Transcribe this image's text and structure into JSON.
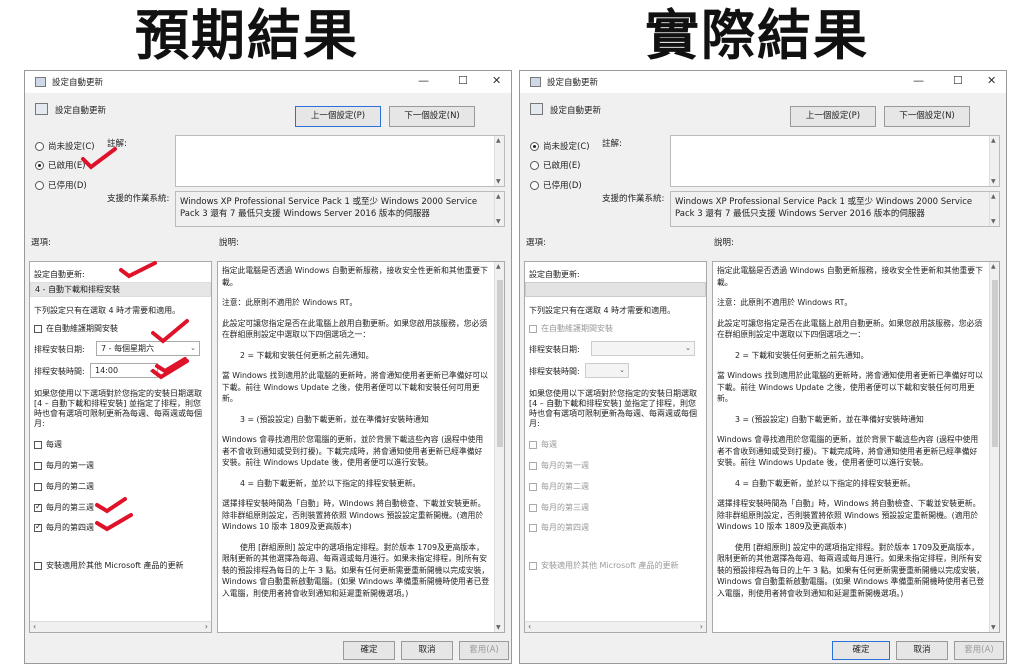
{
  "left": {
    "heading": "預期結果",
    "title": "設定自動更新",
    "subtitle": "設定自動更新",
    "prev_label": "上一個設定(P)",
    "next_label": "下一個設定(N)",
    "radio_not_configured": "尚未設定(C)",
    "radio_enabled": "已啟用(E)",
    "radio_disabled": "已停用(D)",
    "comment_label": "註解:",
    "supported_label": "支援的作業系統:",
    "supported_text": "Windows XP Professional Service Pack 1 或至少 Windows 2000 Service Pack 3 還有 7 最低只支援 Windows Server 2016 版本的伺服器",
    "options_label": "選項:",
    "help_label": "說明:",
    "opt_configure": "設定自動更新:",
    "opt_mode": "4 - 自動下載和排程安裝",
    "opt_note": "下列設定只有在選取 4 時才需要和適用。",
    "opt_maint": "在自動維護期間安裝",
    "opt_day_label": "排程安裝日期:",
    "opt_day_value": "7 - 每個星期六",
    "opt_time_label": "排程安裝時間:",
    "opt_time_value": "14:00",
    "opt_desc1": "如果您使用以下選項對於您指定的安裝日期選取",
    "opt_desc2": "[4 – 自動下載和排程安裝] 並指定了排程，則您",
    "opt_desc3": "時也會有選項可限制更新為每週、每兩週或每個",
    "opt_desc4": "月:",
    "cb_weekly": "每週",
    "cb_w1": "每月的第一週",
    "cb_w2": "每月的第二週",
    "cb_w3": "每月的第三週",
    "cb_w4": "每月的第四週",
    "cb_ms": "安裝適用於其他 Microsoft 產品的更新",
    "ok_label": "確定",
    "cancel_label": "取消",
    "apply_label": "套用(A)"
  },
  "right": {
    "heading": "實際結果",
    "title": "設定自動更新",
    "subtitle": "設定自動更新",
    "prev_label": "上一個設定(P)",
    "next_label": "下一個設定(N)",
    "radio_not_configured": "尚未設定(C)",
    "radio_enabled": "已啟用(E)",
    "radio_disabled": "已停用(D)",
    "comment_label": "註解:",
    "supported_label": "支援的作業系統:",
    "supported_text": "Windows XP Professional Service Pack 1 或至少 Windows 2000 Service Pack 3 還有 7 最低只支援 Windows Server 2016 版本的伺服器",
    "options_label": "選項:",
    "help_label": "說明:",
    "opt_configure": "設定自動更新:",
    "opt_mode": "",
    "opt_note": "下列設定只有在選取 4 時才需要和適用。",
    "opt_maint": "在自動維護期間安裝",
    "opt_day_label": "排程安裝日期:",
    "opt_day_value": "",
    "opt_time_label": "排程安裝時間:",
    "opt_time_value": "",
    "opt_desc1": "如果您使用以下選項對於您指定的安裝日期選取",
    "opt_desc2": "[4 – 自動下載和排程安裝] 並指定了排程，則您",
    "opt_desc3": "時也會有選項可限制更新為每週、每兩週或每個",
    "opt_desc4": "月:",
    "cb_weekly": "每週",
    "cb_w1": "每月的第一週",
    "cb_w2": "每月的第二週",
    "cb_w3": "每月的第三週",
    "cb_w4": "每月的第四週",
    "cb_ms": "安裝適用於其他 Microsoft 產品的更新",
    "ok_label": "確定",
    "cancel_label": "取消",
    "apply_label": "套用(A)"
  },
  "help": {
    "p1": "指定此電腦是否透過 Windows 自動更新服務，接收安全性更新和其他重要下載。",
    "p2": "注意：此原則不適用於 Windows RT。",
    "p3": "此設定可讓您指定是否在此電腦上啟用自動更新。如果您啟用該服務，您必須在群組原則設定中選取以下四個選項之一：",
    "p4": "2 = 下載和安裝任何更新之前先通知。",
    "p5": "當 Windows 找到適用於此電腦的更新時，將會通知使用者更新已準備好可以下載。前往 Windows Update 之後，使用者便可以下載和安裝任何可用更新。",
    "p6": "3 = (預設設定) 自動下載更新，並在準備好安裝時通知",
    "p7": "Windows 會尋找適用於您電腦的更新，並於背景下載這些內容 (過程中使用者不會收到通知或受到打擾)。下載完成時，將會通知使用者更新已經準備好安裝。前往 Windows Update 後，使用者便可以進行安裝。",
    "p8": "4 = 自動下載更新，並於以下指定的排程安裝更新。",
    "p9": "選擇排程安裝時間為「自動」時，Windows 將自動檢查、下載並安裝更新。除非群組原則設定，否則裝置將依照 Windows 預設設定重新開機。(適用於 Windows 10 版本 1809及更高版本)",
    "p10": "使用 [群組原則] 設定中的選項指定排程。對於版本 1709及更高版本，限制更新的其他選擇為每週、每兩週或每月進行。如果未指定排程，則所有安裝的預設排程為每日的上午 3 點。如果有任何更新需要重新開機以完成安裝，Windows 會自動重新啟動電腦。(如果 Windows 準備重新開機時使用者已登入電腦，則使用者將會收到通知和延遲重新開機選項。)"
  },
  "colors": {
    "mark": "#e0122a",
    "primary_border": "#2b6fd8",
    "window_bg": "#f0f0f0"
  }
}
